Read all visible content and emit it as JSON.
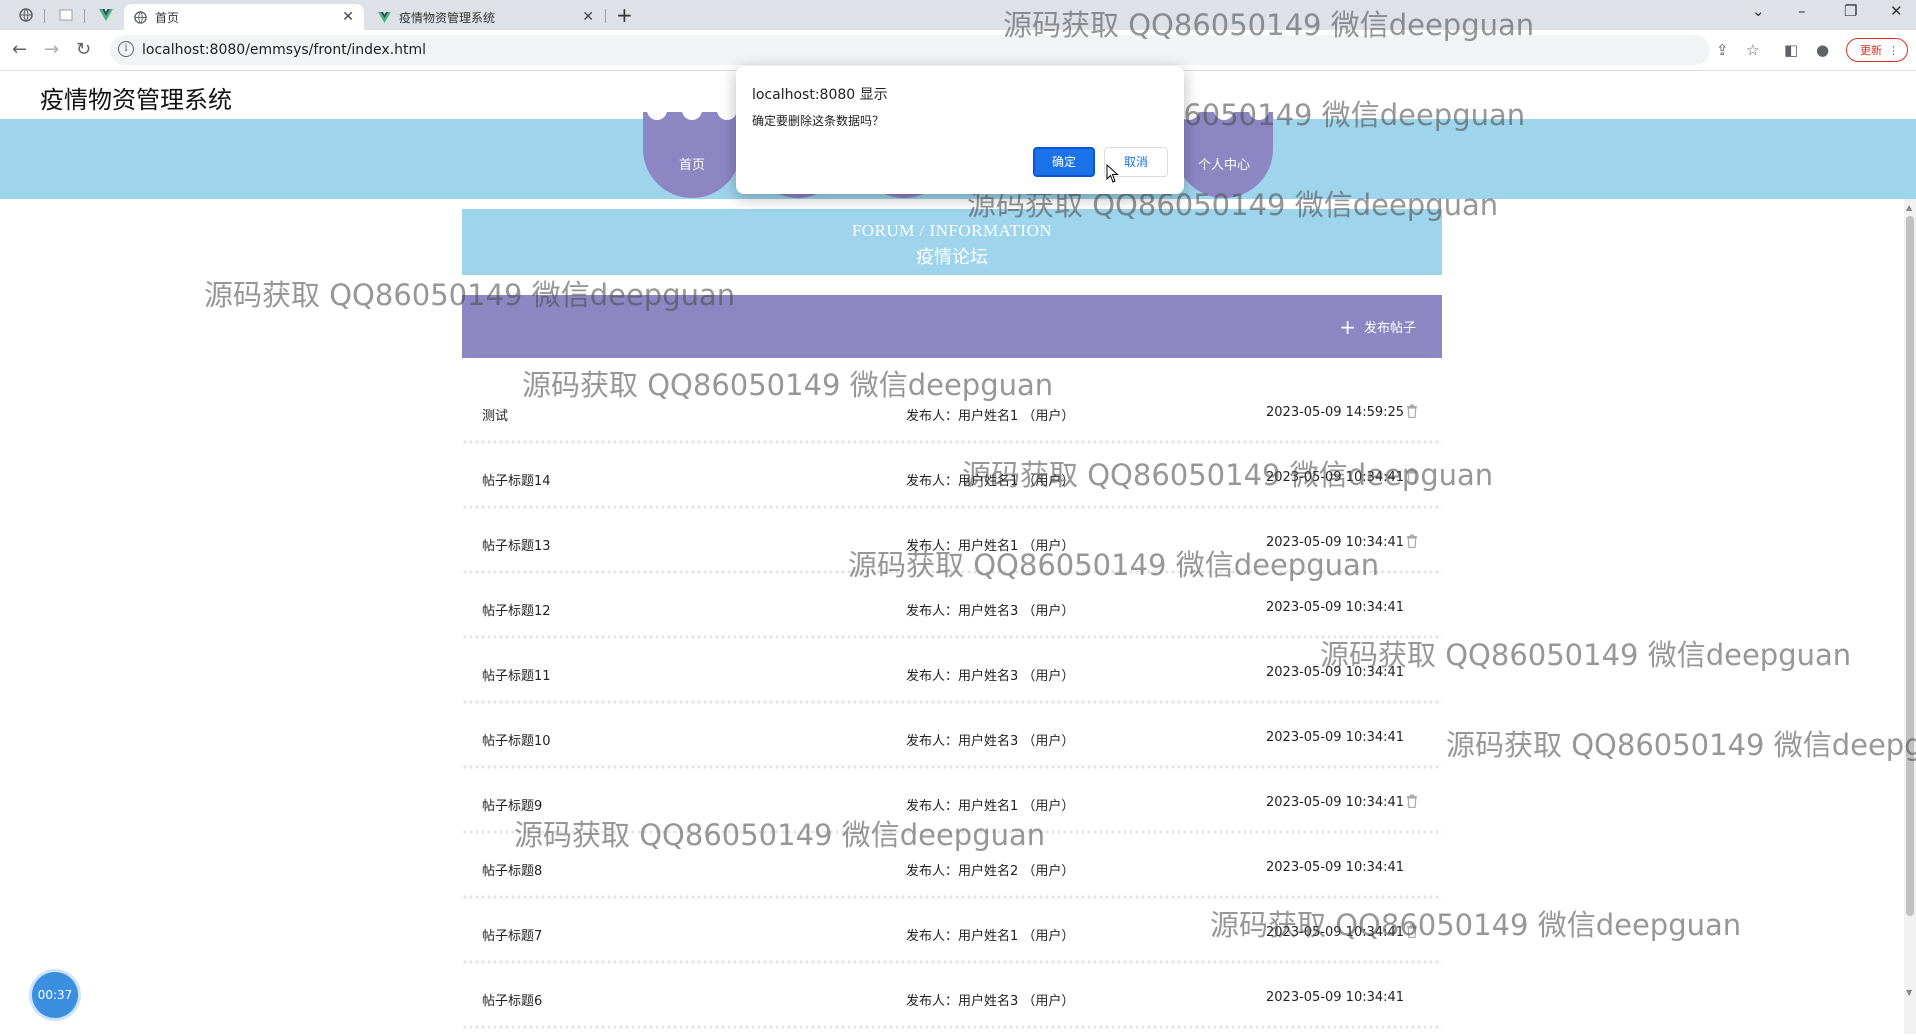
{
  "browser": {
    "tabs": [
      {
        "label": "首页",
        "active": true
      },
      {
        "label": "疫情物资管理系统",
        "active": false
      }
    ],
    "url": "localhost:8080/emmsys/front/index.html",
    "update_label": "更新"
  },
  "site": {
    "title": "疫情物资管理系统",
    "nav": [
      {
        "label": "首页"
      },
      {
        "label": "个人中心"
      }
    ]
  },
  "forum": {
    "banner_en": "FORUM / INFORMATION",
    "banner_cn": "疫情论坛",
    "post_button": "发布帖子",
    "author_prefix": "发布人：",
    "rows": [
      {
        "title": "测试",
        "author": "用户姓名1 （用户）",
        "time": "2023-05-09 14:59:25",
        "deletable": true
      },
      {
        "title": "帖子标题14",
        "author": "用户姓名1 （用户）",
        "time": "2023-05-09 10:34:41",
        "deletable": true
      },
      {
        "title": "帖子标题13",
        "author": "用户姓名1 （用户）",
        "time": "2023-05-09 10:34:41",
        "deletable": true
      },
      {
        "title": "帖子标题12",
        "author": "用户姓名3 （用户）",
        "time": "2023-05-09 10:34:41",
        "deletable": false
      },
      {
        "title": "帖子标题11",
        "author": "用户姓名3 （用户）",
        "time": "2023-05-09 10:34:41",
        "deletable": false
      },
      {
        "title": "帖子标题10",
        "author": "用户姓名3 （用户）",
        "time": "2023-05-09 10:34:41",
        "deletable": false
      },
      {
        "title": "帖子标题9",
        "author": "用户姓名1 （用户）",
        "time": "2023-05-09 10:34:41",
        "deletable": true
      },
      {
        "title": "帖子标题8",
        "author": "用户姓名2 （用户）",
        "time": "2023-05-09 10:34:41",
        "deletable": false
      },
      {
        "title": "帖子标题7",
        "author": "用户姓名1 （用户）",
        "time": "2023-05-09 10:34:41",
        "deletable": true
      },
      {
        "title": "帖子标题6",
        "author": "用户姓名3 （用户）",
        "time": "2023-05-09 10:34:41",
        "deletable": false
      }
    ]
  },
  "dialog": {
    "title": "localhost:8080 显示",
    "message": "确定要删除这条数据吗？",
    "ok_label": "确定",
    "cancel_label": "取消"
  },
  "timer": "00:37",
  "watermark": "源码获取 QQ86050149 微信deepguan",
  "colors": {
    "nav_strip": "#9ed4ec",
    "nav_bubble": "#8c86c3",
    "primary_button": "#1a73e8"
  }
}
